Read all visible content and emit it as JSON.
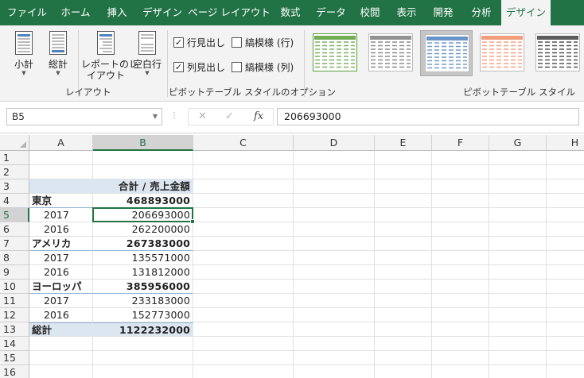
{
  "colors": {
    "accent": "#217346",
    "pivot_band": "#dce6f1",
    "pivot_line": "#95b3d7"
  },
  "tabs": [
    {
      "label": "ファイル",
      "active": false
    },
    {
      "label": "ホーム",
      "active": false
    },
    {
      "label": "挿入",
      "active": false
    },
    {
      "label": "デザイン",
      "active": false
    },
    {
      "label": "ページ レイアウト",
      "active": false
    },
    {
      "label": "数式",
      "active": false
    },
    {
      "label": "データ",
      "active": false
    },
    {
      "label": "校閲",
      "active": false
    },
    {
      "label": "表示",
      "active": false
    },
    {
      "label": "開発",
      "active": false
    },
    {
      "label": "分析",
      "active": false
    },
    {
      "label": "デザイン",
      "active": true
    }
  ],
  "ribbon": {
    "layout_group": {
      "label": "レイアウト",
      "subtotal": "小計",
      "grand_total": "総計",
      "report_layout_line1": "レポートのレ",
      "report_layout_line2": "イアウト",
      "blank_rows": "空白行"
    },
    "options_group": {
      "label": "ピボットテーブル スタイルのオプション",
      "row_headers": {
        "label": "行見出し",
        "checked": true
      },
      "banded_rows": {
        "label": "縞模様 (行)",
        "checked": false
      },
      "column_headers": {
        "label": "列見出し",
        "checked": true
      },
      "banded_columns": {
        "label": "縞模様 (列)",
        "checked": false
      }
    },
    "styles_group": {
      "label": "ピボットテーブル スタイル",
      "selected_index": 2,
      "swatches": [
        "#5a9e3a",
        "#7f7f7f",
        "#4f81bd",
        "#f08c64",
        "#404040"
      ]
    }
  },
  "formula_bar": {
    "name_box": "B5",
    "fx_label": "fx",
    "value": "206693000"
  },
  "sheet": {
    "columns": [
      "A",
      "B",
      "C",
      "D",
      "E",
      "F",
      "G",
      "H"
    ],
    "rows": [
      "1",
      "2",
      "3",
      "4",
      "5",
      "6",
      "7",
      "8",
      "9",
      "10",
      "11",
      "12",
      "13",
      "14",
      "15",
      "16"
    ],
    "selected_cell": "B5",
    "pivot": {
      "header_label": "合計 / 売上金額",
      "groups": [
        {
          "name": "東京",
          "total": "468893000",
          "items": [
            {
              "year": "2017",
              "value": "206693000"
            },
            {
              "year": "2016",
              "value": "262200000"
            }
          ]
        },
        {
          "name": "アメリカ",
          "total": "267383000",
          "items": [
            {
              "year": "2017",
              "value": "135571000"
            },
            {
              "year": "2016",
              "value": "131812000"
            }
          ]
        },
        {
          "name": "ヨーロッパ",
          "total": "385956000",
          "items": [
            {
              "year": "2017",
              "value": "233183000"
            },
            {
              "year": "2016",
              "value": "152773000"
            }
          ]
        }
      ],
      "grand_total_label": "総計",
      "grand_total_value": "1122232000"
    }
  }
}
